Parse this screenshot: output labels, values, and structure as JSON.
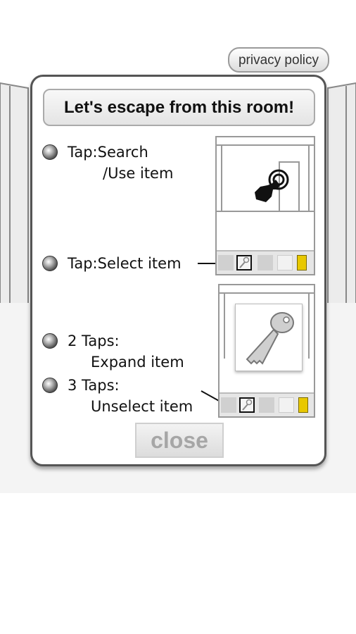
{
  "privacy_label": "privacy policy",
  "panel": {
    "title": "Let's escape from this room!",
    "instructions": {
      "tap_search": "Tap:Search",
      "use_item": "/Use item",
      "tap_select": "Tap:Select item",
      "two_taps": "2 Taps:",
      "expand": "Expand item",
      "three_taps": "3 Taps:",
      "unselect": "Unselect item"
    },
    "close_label": "close"
  }
}
